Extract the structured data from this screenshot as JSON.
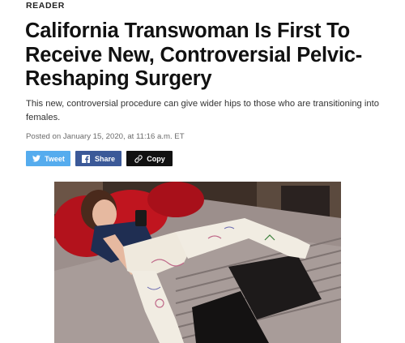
{
  "section": {
    "label": "READER"
  },
  "article": {
    "headline": "California Transwoman Is First To Receive New, Controversial Pelvic-Reshaping Surgery",
    "dek": "This new, controversial procedure can give wider hips to those who are transitioning into females.",
    "meta": "Posted on January 15, 2020, at 11:16 a.m. ET"
  },
  "share": {
    "tweet_label": "Tweet",
    "share_label": "Share",
    "copy_label": "Copy",
    "icons": {
      "tweet": "twitter-bird-icon",
      "share": "facebook-icon",
      "copy": "link-icon"
    },
    "colors": {
      "tweet": "#55acee",
      "share": "#3b5998",
      "copy": "#111111"
    }
  },
  "photo": {
    "subject": "woman-lying-on-bed-in-leg-casts-image"
  }
}
